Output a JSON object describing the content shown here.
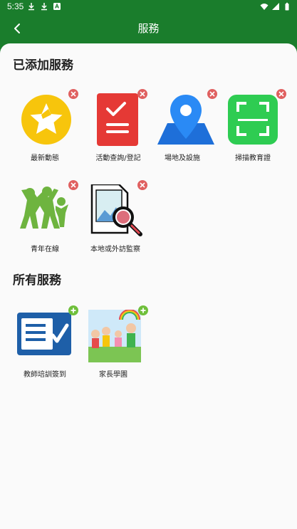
{
  "status_bar": {
    "time": "5:35"
  },
  "header": {
    "title": "服務"
  },
  "added_section": {
    "title": "已添加服務",
    "items": [
      {
        "label": "最新動態",
        "icon": "star-icon"
      },
      {
        "label": "活動查詢/登記",
        "icon": "checklist-icon"
      },
      {
        "label": "場地及設施",
        "icon": "map-pin-icon"
      },
      {
        "label": "掃描教育證",
        "icon": "scan-icon"
      },
      {
        "label": "青年在線",
        "icon": "people-icon"
      },
      {
        "label": "本地或外訪監察",
        "icon": "document-search-icon"
      }
    ]
  },
  "all_section": {
    "title": "所有服務",
    "items": [
      {
        "label": "教師培訓簽到",
        "icon": "form-check-icon"
      },
      {
        "label": "家長學園",
        "icon": "family-icon"
      }
    ]
  },
  "colors": {
    "brand": "#1a7d2c",
    "accent": "#8bc34a",
    "remove": "#e06060",
    "add": "#6fbf3b"
  }
}
